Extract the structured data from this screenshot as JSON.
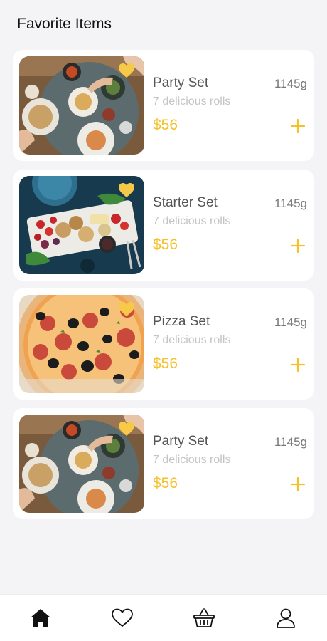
{
  "header": {
    "title": "Favorite Items"
  },
  "colors": {
    "accent": "#f5c028",
    "heart": "#f7c948",
    "background": "#f4f4f6"
  },
  "items": [
    {
      "name": "Party Set",
      "weight": "1145g",
      "description": "7 delicious rolls",
      "price": "$56",
      "image": "party-table-photo",
      "favorite": true
    },
    {
      "name": "Starter Set",
      "weight": "1145g",
      "description": "7 delicious rolls",
      "price": "$56",
      "image": "starter-platter-photo",
      "favorite": true
    },
    {
      "name": "Pizza Set",
      "weight": "1145g",
      "description": "7 delicious rolls",
      "price": "$56",
      "image": "pizza-photo",
      "favorite": true
    },
    {
      "name": "Party Set",
      "weight": "1145g",
      "description": "7 delicious rolls",
      "price": "$56",
      "image": "party-table-photo",
      "favorite": true
    }
  ],
  "bottom_nav": {
    "items": [
      {
        "icon": "home-icon",
        "active": true
      },
      {
        "icon": "heart-icon",
        "active": false
      },
      {
        "icon": "basket-icon",
        "active": false
      },
      {
        "icon": "user-icon",
        "active": false
      }
    ]
  }
}
